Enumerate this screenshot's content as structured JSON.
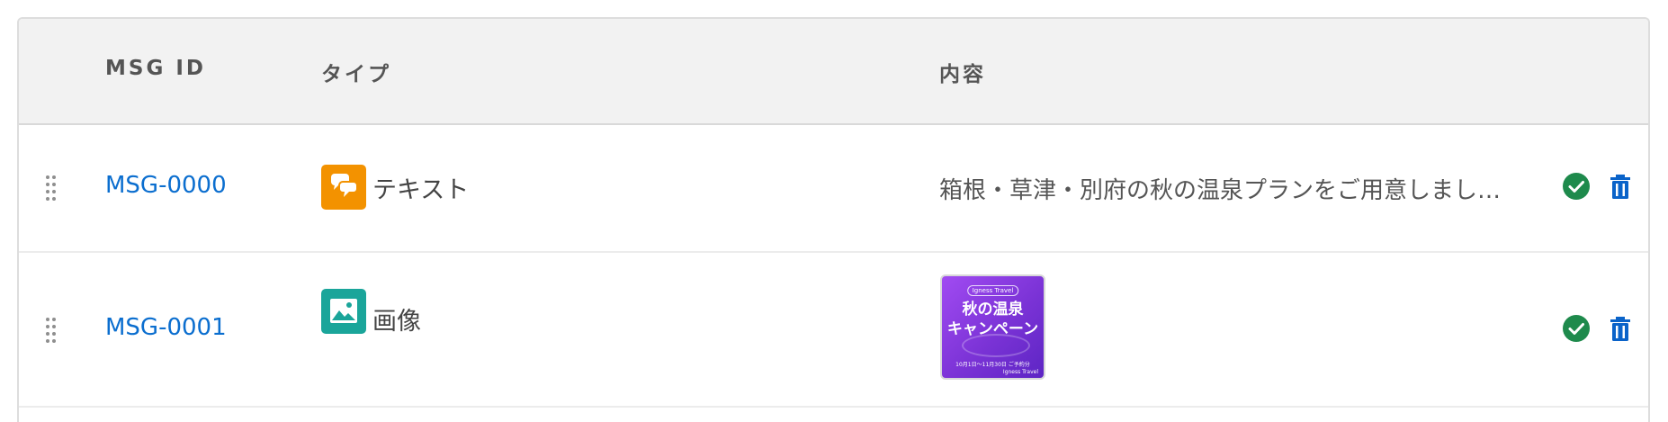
{
  "columns": {
    "msg_id": "MSG ID",
    "type": "タイプ",
    "content": "内容"
  },
  "rows": [
    {
      "id": "MSG-0000",
      "type_label": "テキスト",
      "type_icon": "chat-bubbles-icon",
      "type_color": "#f39200",
      "content": "箱根・草津・別府の秋の温泉プランをご用意しました…",
      "status_icon": "check-circle-icon",
      "delete_icon": "trash-icon"
    },
    {
      "id": "MSG-0001",
      "type_label": "画像",
      "type_icon": "image-icon",
      "type_color": "#1aa59a",
      "image": {
        "brand": "Igness Travel",
        "headline": "秋の温泉\nキャンペーン",
        "period": "10月1日〜11月30日 ご予約分",
        "brand_footer": "Igness Travel"
      },
      "status_icon": "check-circle-icon",
      "delete_icon": "trash-icon"
    }
  ],
  "colors": {
    "link": "#0b6ecf",
    "success": "#1e8a4c",
    "delete": "#0a63c9",
    "header_bg": "#f2f2f2"
  }
}
